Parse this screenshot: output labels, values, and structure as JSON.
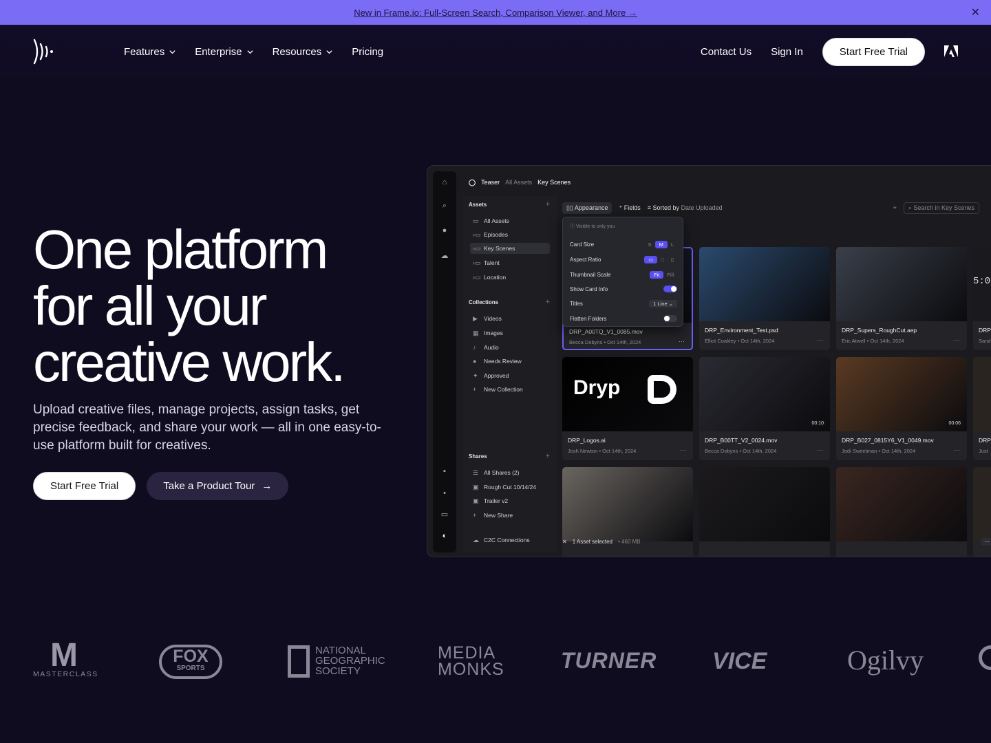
{
  "banner": {
    "text": "New in Frame.io: Full-Screen Search, Comparison Viewer, and More →"
  },
  "nav": {
    "links": [
      {
        "label": "Features",
        "dropdown": true
      },
      {
        "label": "Enterprise",
        "dropdown": true
      },
      {
        "label": "Resources",
        "dropdown": true
      },
      {
        "label": "Pricing",
        "dropdown": false
      }
    ],
    "contact": "Contact Us",
    "sign_in": "Sign In",
    "cta": "Start Free Trial"
  },
  "hero": {
    "title_lines": [
      "One platform",
      "for all your",
      "creative work."
    ],
    "subtitle": "Upload creative files, manage projects, assign tasks, get precise feedback, and share your work — all in one easy-to-use platform built for creatives.",
    "primary_cta": "Start Free Trial",
    "secondary_cta": "Take a Product Tour",
    "secondary_arrow": "→"
  },
  "app": {
    "breadcrumb": {
      "project": "Teaser",
      "root": "All Assets",
      "current": "Key Scenes"
    },
    "assets_header": "Assets",
    "assets": [
      {
        "label": "All Assets"
      },
      {
        "label": "Episodes"
      },
      {
        "label": "Key Scenes"
      },
      {
        "label": "Talent"
      },
      {
        "label": "Location"
      }
    ],
    "collections_header": "Collections",
    "collections": [
      {
        "label": "Videos"
      },
      {
        "label": "Images"
      },
      {
        "label": "Audio"
      },
      {
        "label": "Needs Review"
      },
      {
        "label": "Approved"
      },
      {
        "label": "New Collection"
      }
    ],
    "shares_header": "Shares",
    "shares": [
      {
        "label": "All Shares (2)"
      },
      {
        "label": "Rough Cut 10/14/24"
      },
      {
        "label": "Trailer v2"
      },
      {
        "label": "New Share"
      }
    ],
    "c2c": "C2C Connections",
    "toolbar": {
      "appearance": "Appearance",
      "fields": "Fields",
      "sorted_by": "Sorted by",
      "sort_value": "Date Uploaded",
      "search_placeholder": "Search in Key Scenes"
    },
    "popover": {
      "visible_note": "Visible to only you",
      "card_size": "Card Size",
      "size_s": "S",
      "size_m": "M",
      "size_l": "L",
      "aspect_ratio": "Aspect Ratio",
      "thumbnail_scale": "Thumbnail Scale",
      "fit": "Fit",
      "fill": "Fill",
      "show_card_info": "Show Card Info",
      "titles": "Titles",
      "titles_value": "1 Line",
      "flatten_folders": "Flatten Folders"
    },
    "cards": [
      {
        "name": "DRP_A00TQ_V1_0085.mov",
        "author": "Becca Dobyns",
        "date": "Oct 14th, 2024",
        "duration": "",
        "thumb_color": "#1e2a44"
      },
      {
        "name": "DRP_Environment_Test.psd",
        "author": "Elliot Coakley",
        "date": "Oct 14th, 2024",
        "duration": "",
        "thumb_color": "#2a4a6e"
      },
      {
        "name": "DRP_Supers_RoughCut.aep",
        "author": "Eric Atwell",
        "date": "Oct 14th, 2024",
        "duration": "",
        "thumb_color": "#3a3f4a"
      },
      {
        "name": "DRP_Logos.ai",
        "author": "Josh Newton",
        "date": "Oct 14th, 2024",
        "duration": "",
        "thumb_color": "#000000"
      },
      {
        "name": "DRP_B00TT_V2_0024.mov",
        "author": "Becca Dobyns",
        "date": "Oct 14th, 2024",
        "duration": "00:10",
        "thumb_color": "#2a2a32"
      },
      {
        "name": "DRP_B027_0815Y6_V1_0049.mov",
        "author": "Jodi Sweetman",
        "date": "Oct 14th, 2024",
        "duration": "00:06",
        "thumb_color": "#5a3a22"
      },
      {
        "name": "",
        "author": "",
        "date": "",
        "duration": "",
        "thumb_color": "#6a6560"
      },
      {
        "name": "",
        "author": "",
        "date": "",
        "duration": "",
        "thumb_color": "#1c1a1c"
      },
      {
        "name": "",
        "author": "",
        "date": "",
        "duration": "",
        "thumb_color": "#3a2620"
      }
    ],
    "partial_cards": [
      {
        "name": "DRP",
        "author": "Sand"
      },
      {
        "name": "DRP",
        "author": "Just"
      }
    ],
    "partial_thumb_text": "5:0",
    "logo_card_wordmark": "Dryp",
    "bottom": {
      "selected": "1 Asset selected",
      "size": "460 MB"
    }
  },
  "logos": [
    {
      "name": "masterclass-logo",
      "text": "MASTERCLASS",
      "mark": "M"
    },
    {
      "name": "fox-sports-logo",
      "text": "FOX",
      "sub": "SPORTS"
    },
    {
      "name": "national-geographic-logo",
      "lines": [
        "NATIONAL",
        "GEOGRAPHIC",
        "SOCIETY"
      ]
    },
    {
      "name": "media-monks-logo",
      "lines": [
        "MEDIA",
        "MONKS"
      ]
    },
    {
      "name": "turner-logo",
      "text": "TURNER"
    },
    {
      "name": "vice-logo",
      "text": "VICE"
    },
    {
      "name": "ogilvy-logo",
      "text": "Ogilvy"
    }
  ],
  "colors": {
    "banner": "#7b6cf6",
    "background": "#0f0c20",
    "accent": "#5a4ff0"
  }
}
